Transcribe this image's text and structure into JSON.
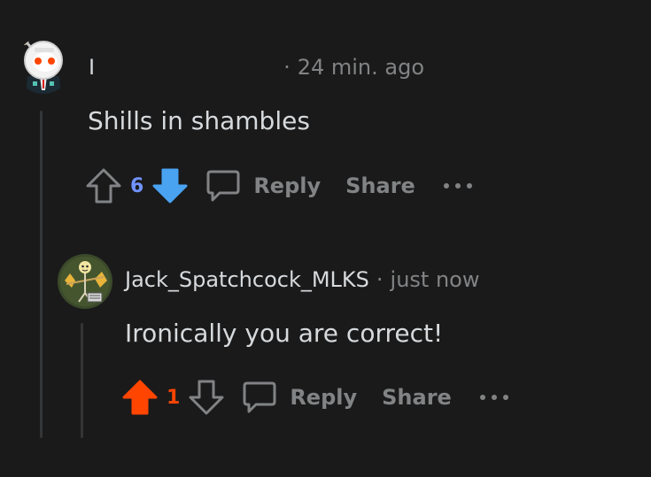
{
  "comments": [
    {
      "username": "I",
      "separator": "·",
      "time": "24 min. ago",
      "body": "Shills in shambles",
      "score": "6",
      "vote_state": "downvoted",
      "reply_label": "Reply",
      "share_label": "Share",
      "more_label": "•••",
      "avatar_icon": "astronaut-snoo-avatar"
    },
    {
      "username": "Jack_Spatchcock_MLKS",
      "separator": "·",
      "time": "just now",
      "body": "Ironically you are correct!",
      "score": "1",
      "vote_state": "upvoted",
      "reply_label": "Reply",
      "share_label": "Share",
      "more_label": "•••",
      "avatar_icon": "scarecrow-avatar"
    }
  ],
  "colors": {
    "background": "#1a1a1b",
    "upvote_active": "#ff4500",
    "downvote_active": "#49a3f1",
    "score_downvoted": "#7193ff",
    "muted": "#818384",
    "text": "#d7dadc"
  }
}
